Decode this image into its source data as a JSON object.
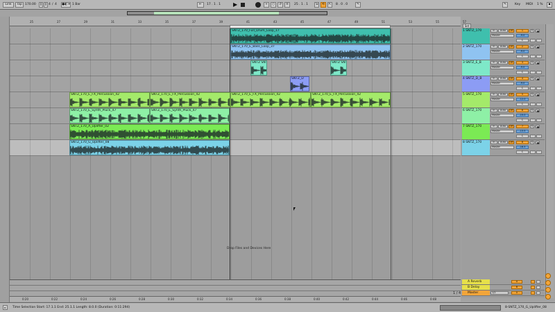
{
  "topbar": {
    "link_label": "Link",
    "tap_label": "Tap",
    "tempo": "170.00",
    "time_sig_num": "4",
    "time_sig_den": "4",
    "metro": "1 Bar",
    "position": "17 .   1 .   1",
    "loop_start": "25 .   1 .   1",
    "loop_length": "8 .   0 .   0",
    "key_label": "Key",
    "midi_label": "MIDI",
    "cpu": "1 %"
  },
  "ruler": {
    "ticks": [
      "25",
      "27",
      "29",
      "31",
      "33",
      "35",
      "37",
      "39",
      "41",
      "43",
      "45",
      "47",
      "49",
      "51",
      "53",
      "55",
      "57"
    ]
  },
  "time_ruler": {
    "ticks": [
      "0:20",
      "0:22",
      "0:24",
      "0:26",
      "0:28",
      "0:30",
      "0:32",
      "0:34",
      "0:36",
      "0:38",
      "0:40",
      "0:42",
      "0:44",
      "0:46",
      "0:48"
    ]
  },
  "clips": [
    {
      "lane": 0,
      "title": "SNTZ_170_Full_Drum_Loop_17",
      "color": "#3fbfad"
    },
    {
      "lane": 1,
      "title": "SNTZ_170_E_Bass_Loop_37",
      "color": "#8fc3f1"
    },
    {
      "lane": 2,
      "title": "SNTZ SNTZ",
      "color": "#7ee8c8"
    },
    {
      "lane": 2,
      "title": "SNTZ SNTZ",
      "color": "#7ee8c8"
    },
    {
      "lane": 3,
      "title": "SNTZ_D",
      "color": "#8c9cf4"
    },
    {
      "lane": 4,
      "title": "SNTZ_170_E_FX_Percussion_42",
      "color": "#a4ea6a"
    },
    {
      "lane": 4,
      "title": "SNTZ_170_E_FX_Percussion_42",
      "color": "#a4ea6a"
    },
    {
      "lane": 4,
      "title": "SNTZ_170_E_FX_Percussion_42",
      "color": "#a4ea6a"
    },
    {
      "lane": 4,
      "title": "SNTZ_170_E_FX_Percussion_42",
      "color": "#a4ea6a"
    },
    {
      "lane": 5,
      "title": "SNTZ_170_E_Synth_Pluck_47",
      "color": "#8ef0a6"
    },
    {
      "lane": 5,
      "title": "SNTZ_170_E_Synth_Pluck_47",
      "color": "#8ef0a6"
    },
    {
      "lane": 6,
      "title": "SNTZ_170_A_Uplifter_02",
      "color": "#7bea54"
    },
    {
      "lane": 7,
      "title": "SNTZ_170_G_Uplifter_08",
      "color": "#7cd2e8"
    }
  ],
  "drop_hint": "Drop Files and Devices Here",
  "tracks": [
    {
      "name": "1 SNTZ_170",
      "color": "#3fbfad",
      "in": "In",
      "auto": "Auto",
      "off": "Off",
      "out": "Master",
      "num": "1",
      "vol": "-9.0",
      "c": "C"
    },
    {
      "name": "2 SNTZ_170",
      "color": "#8fc3f1",
      "in": "In",
      "auto": "Auto",
      "off": "Off",
      "out": "Master",
      "num": "2",
      "vol": "-9.0",
      "c": "C"
    },
    {
      "name": "3 SNTZ_E_B",
      "color": "#7ee8c8",
      "in": "In",
      "auto": "Auto",
      "off": "Off",
      "out": "Master",
      "num": "3",
      "vol": "-9.0",
      "c": "C"
    },
    {
      "name": "4 SNTZ_D_B",
      "color": "#8c9cf4",
      "in": "In",
      "auto": "Auto",
      "off": "Off",
      "out": "Master",
      "num": "4",
      "vol": "-9.0",
      "c": "C"
    },
    {
      "name": "5 SNTZ_170",
      "color": "#a4ea6a",
      "in": "In",
      "auto": "Auto",
      "off": "Off",
      "out": "Master",
      "num": "5",
      "vol": "-12.0",
      "c": "C"
    },
    {
      "name": "6 SNTZ_170",
      "color": "#8ef0a6",
      "in": "In",
      "auto": "Auto",
      "off": "Off",
      "out": "Master",
      "num": "6",
      "vol": "-15.0",
      "c": "C"
    },
    {
      "name": "7 SNTZ_170",
      "color": "#7bea54",
      "in": "In",
      "auto": "Auto",
      "off": "Off",
      "out": "Master",
      "num": "7",
      "vol": "-13.5",
      "c": "C"
    },
    {
      "name": "8 SNTZ_170",
      "color": "#7cd2e8",
      "in": "In",
      "auto": "Auto",
      "off": "Off",
      "out": "Master",
      "num": "8",
      "vol": "-16.5",
      "c": "C"
    }
  ],
  "returns": [
    {
      "name": "A Reverb",
      "color": "#e6e04a",
      "num": "A"
    },
    {
      "name": "B Delay",
      "color": "#e6e04a",
      "num": "B"
    },
    {
      "name": "Master",
      "color": "#f2a53a",
      "num": "0",
      "extra": "1/2"
    }
  ],
  "status": {
    "text": "Time Selection  Start: 17.1.1   End: 25.1.1   Length: 8.0.0  (Duration: 0:11:294)",
    "right": "8-SNTZ_170_G_Uplifter_08",
    "page": "1 / 4"
  }
}
